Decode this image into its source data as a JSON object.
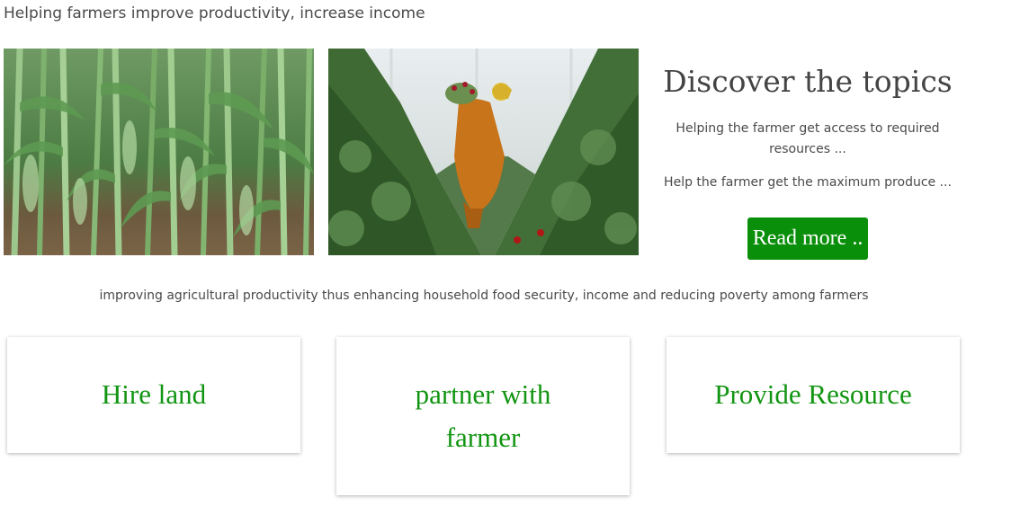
{
  "header": {
    "tagline": "Helping farmers improve productivity, increase income"
  },
  "gallery": {
    "images": [
      {
        "subject": "maize field"
      },
      {
        "subject": "farm worker carrying flowers in greenhouse"
      }
    ]
  },
  "discover": {
    "title": "Discover the topics",
    "line1": "Helping the farmer get access to required resources ...",
    "line2": "Help the farmer get the maximum produce ...",
    "button_label": "Read more .."
  },
  "mission": {
    "text": "improving agricultural productivity thus enhancing household food security, income and reducing poverty among farmers"
  },
  "cards": [
    {
      "label": "Hire land"
    },
    {
      "label": "partner with farmer"
    },
    {
      "label": "Provide Resource"
    }
  ],
  "colors": {
    "accent_green": "#0a8f0a",
    "card_text_green": "#129512"
  }
}
